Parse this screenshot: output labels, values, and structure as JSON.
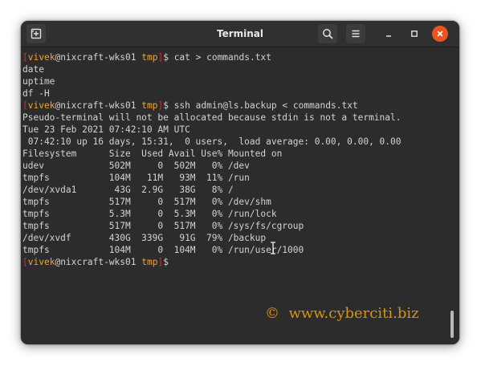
{
  "window": {
    "title": "Terminal"
  },
  "icons": {
    "new_tab": "new-tab-icon",
    "search": "search-icon",
    "menu": "hamburger-menu-icon",
    "minimize": "minimize-icon",
    "maximize": "maximize-icon",
    "close": "close-icon"
  },
  "colors": {
    "prompt_bracket": "#cc3333",
    "prompt_user_dir": "#f2a22e",
    "text": "#d3d3d3",
    "background": "#2c2c2c",
    "close_button": "#e95420",
    "watermark": "#d8920c"
  },
  "prompt": {
    "open": "[",
    "user": "vivek",
    "at": "@",
    "host": "nixcraft-wks01",
    "space": " ",
    "dir": "tmp",
    "close": "]",
    "dollar": "$"
  },
  "lines": [
    {
      "prompt": true,
      "cmd": " cat > commands.txt"
    },
    {
      "text": "date"
    },
    {
      "text": "uptime"
    },
    {
      "text": "df -H"
    },
    {
      "prompt": true,
      "cmd": " ssh admin@ls.backup < commands.txt"
    },
    {
      "text": "Pseudo-terminal will not be allocated because stdin is not a terminal."
    },
    {
      "text": "Tue 23 Feb 2021 07:42:10 AM UTC"
    },
    {
      "text": " 07:42:10 up 16 days, 15:31,  0 users,  load average: 0.00, 0.00, 0.00"
    },
    {
      "text": "Filesystem      Size  Used Avail Use% Mounted on"
    },
    {
      "text": "udev            502M     0  502M   0% /dev"
    },
    {
      "text": "tmpfs           104M   11M   93M  11% /run"
    },
    {
      "text": "/dev/xvda1       43G  2.9G   38G   8% /"
    },
    {
      "text": "tmpfs           517M     0  517M   0% /dev/shm"
    },
    {
      "text": "tmpfs           5.3M     0  5.3M   0% /run/lock"
    },
    {
      "text": "tmpfs           517M     0  517M   0% /sys/fs/cgroup"
    },
    {
      "text": "/dev/xvdf       430G  339G   91G  79% /backup"
    },
    {
      "text": "tmpfs           104M     0  104M   0% /run/user/1000"
    },
    {
      "prompt": true,
      "cmd": ""
    }
  ],
  "watermark": "©  www.cyberciti.biz"
}
